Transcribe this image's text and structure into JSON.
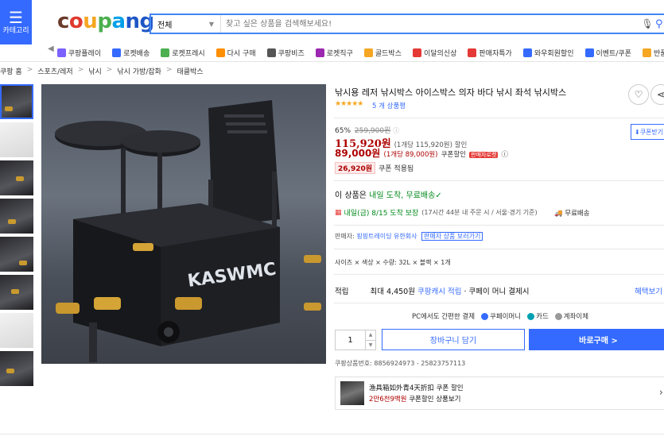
{
  "header": {
    "category_label": "카테고리",
    "logo": "coupang",
    "search": {
      "category_value": "전체",
      "placeholder": "찾고 싶은 상품을 검색해보세요!"
    }
  },
  "nav": [
    {
      "label": "쿠팡플레이",
      "color": "#7b61ff"
    },
    {
      "label": "로켓배송",
      "color": "#346aff"
    },
    {
      "label": "로켓프레시",
      "color": "#4caf50"
    },
    {
      "label": "다시 구매",
      "color": "#ff8f00"
    },
    {
      "label": "쿠팡비즈",
      "color": "#555555"
    },
    {
      "label": "로켓직구",
      "color": "#9c27b0"
    },
    {
      "label": "골드박스",
      "color": "#f5a623"
    },
    {
      "label": "이달의신상",
      "color": "#e53935"
    },
    {
      "label": "판매자특가",
      "color": "#e53935"
    },
    {
      "label": "와우회원할인",
      "color": "#346aff"
    },
    {
      "label": "이벤트/쿠폰",
      "color": "#346aff"
    },
    {
      "label": "반품마켓",
      "color": "#f5a623"
    }
  ],
  "breadcrumb": [
    "쿠팡 홈",
    "스포츠/레저",
    "낚시",
    "낚시 가방/잡화",
    "태클박스"
  ],
  "product": {
    "title": "낚시용 레저 낚시박스 아이스박스 의자 바다 낚시 좌석 낚시박스",
    "stars": "★★★★★",
    "review_count": "5 개 상품평",
    "discount_rate": "65%",
    "original_price": "259,900원",
    "sale_price": "115,920원",
    "sale_unit": "(1개당 115,920원) 할인",
    "coupon_price": "89,000원",
    "coupon_unit": "(1개당 89,000원)",
    "coupon_label": "쿠폰할인",
    "seller_badge": "판매자로켓",
    "coupon_amount": "26,920원",
    "coupon_apply": "쿠폰 적용됨",
    "coupon_download": "쿠폰받기",
    "arrival_pre": "이 상품은 ",
    "arrival_green": "내일 도착, 무료배송",
    "delivery_date": "내일(금) 8/15 도착 보장",
    "delivery_note": "(17시간 44분 내 주문 시 / 서울·경기 기준)",
    "delivery_type": "무료배송",
    "seller_label": "판매자: ",
    "seller_name": "핑핑트레이딩 유한회사",
    "seller_other": "판매자 상품 보러가기",
    "options": "사이즈 × 색상 × 수량: 32L × 블랙 × 1개",
    "reward_label": "적립",
    "reward_text": "최대 4,450원",
    "reward_link": "쿠팡캐시 적립",
    "reward_suffix": " · 쿠페이 머니 결제시",
    "reward_benefit": "혜택보기",
    "pay_label": "PC에서도 간편한 결제",
    "pay_methods": [
      {
        "label": "쿠페이머니",
        "color": "#346aff"
      },
      {
        "label": "카드",
        "color": "#00a0b0"
      },
      {
        "label": "계좌이체",
        "color": "#999999"
      }
    ],
    "quantity": "1",
    "cart_label": "장바구니 담기",
    "buy_label": "바로구매 >",
    "product_id": "쿠팡상품번호: 8856924973 - 25823757113",
    "promo_title": "渔具箱如外青4天折扣 쿠폰 할인",
    "promo_price": "2만6천9백원",
    "promo_suffix": " 쿠폰할인 상품보기"
  },
  "gallery": {
    "brand_text": "KASWMC"
  }
}
